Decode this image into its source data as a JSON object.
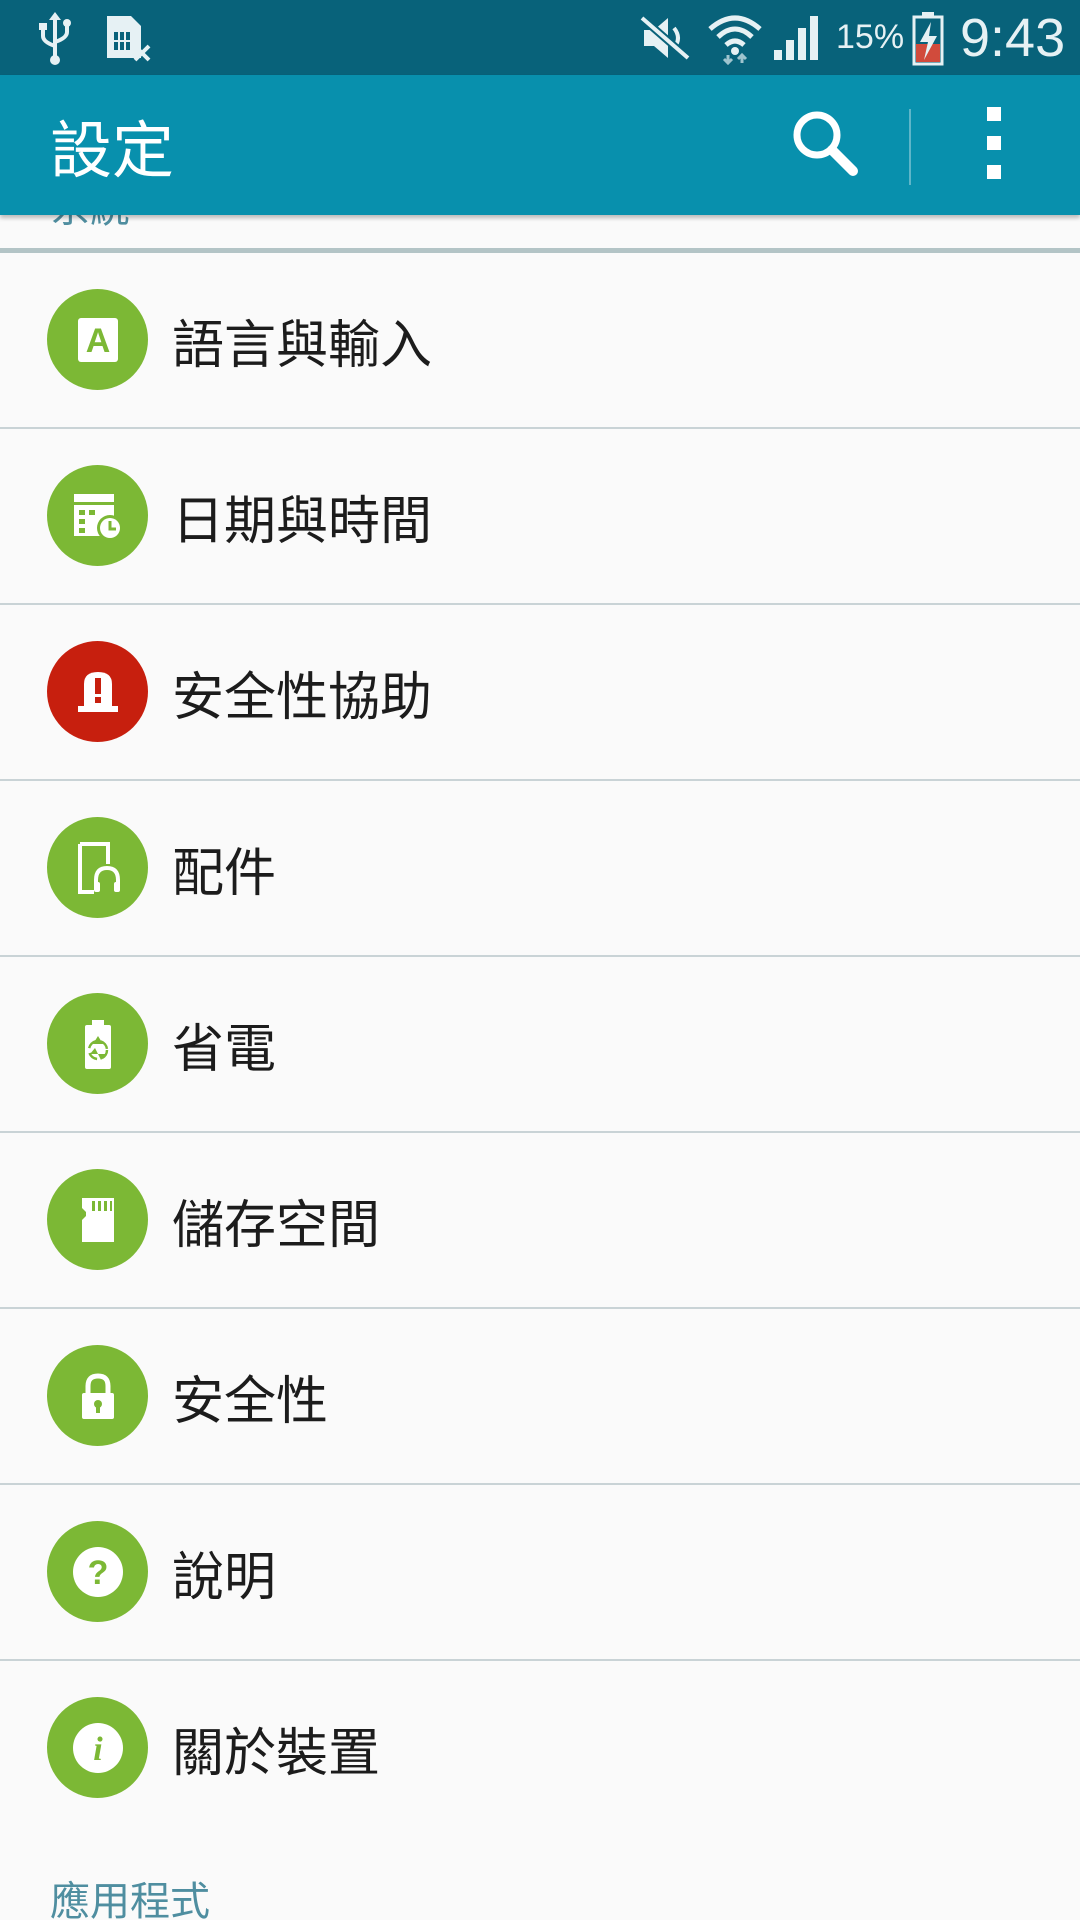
{
  "status_bar": {
    "battery_percent": "15%",
    "time": "9:43",
    "icons": [
      "usb-icon",
      "sim-card-error-icon",
      "mute-icon",
      "wifi-icon",
      "signal-icon",
      "battery-charging-icon"
    ]
  },
  "app_bar": {
    "title": "設定",
    "actions": [
      "search-icon",
      "more-options-icon"
    ]
  },
  "previous_section": {
    "label": "系統"
  },
  "items": [
    {
      "label": "語言與輸入",
      "icon": "language-input-icon",
      "color": "#7cb835"
    },
    {
      "label": "日期與時間",
      "icon": "date-time-icon",
      "color": "#7cb835"
    },
    {
      "label": "安全性協助",
      "icon": "emergency-alert-icon",
      "color": "#c71f0e"
    },
    {
      "label": "配件",
      "icon": "accessory-icon",
      "color": "#7cb835"
    },
    {
      "label": "省電",
      "icon": "power-saving-icon",
      "color": "#7cb835"
    },
    {
      "label": "儲存空間",
      "icon": "storage-icon",
      "color": "#7cb835"
    },
    {
      "label": "安全性",
      "icon": "lock-icon",
      "color": "#7cb835"
    },
    {
      "label": "說明",
      "icon": "help-icon",
      "color": "#7cb835"
    },
    {
      "label": "關於裝置",
      "icon": "about-device-icon",
      "color": "#7cb835"
    }
  ],
  "next_section": {
    "label": "應用程式"
  },
  "colors": {
    "status_bar": "#08627a",
    "app_bar": "#0890ad",
    "green": "#7cb835",
    "red": "#c71f0e",
    "section_text": "#4f8ea0"
  }
}
